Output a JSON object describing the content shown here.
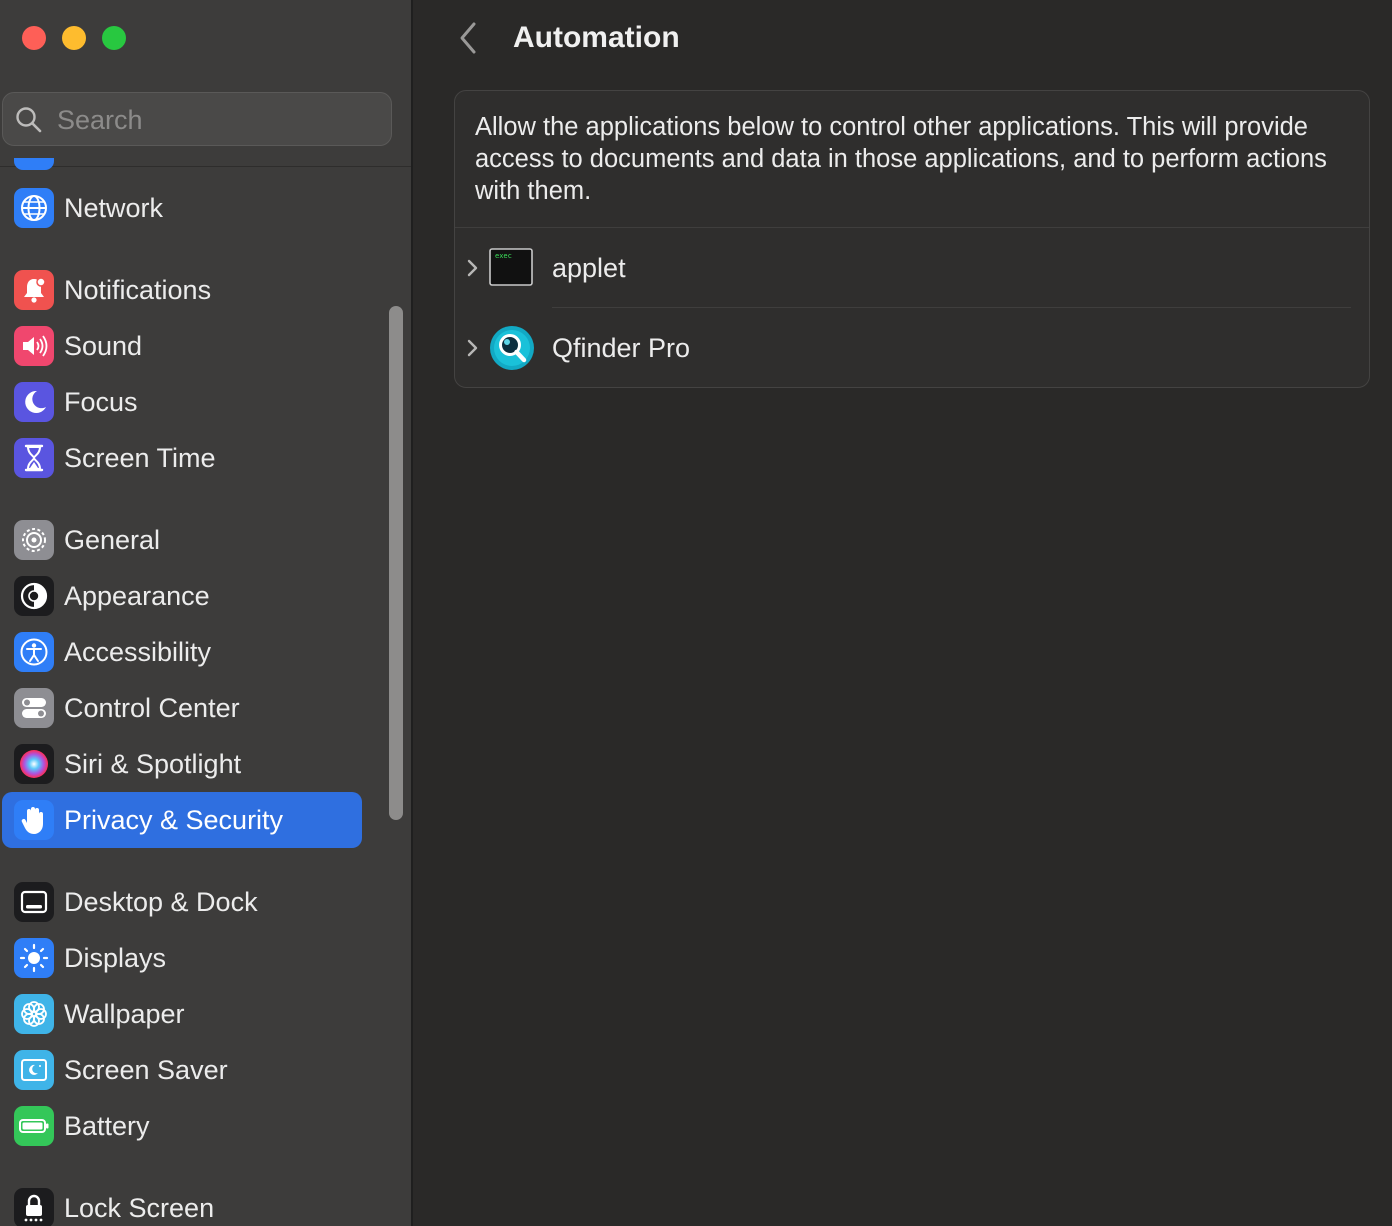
{
  "window": {
    "controls": [
      "close",
      "minimize",
      "zoom"
    ]
  },
  "search": {
    "placeholder": "Search"
  },
  "sidebar": {
    "items": [
      {
        "label": "Network",
        "icon": "network-globe-icon",
        "color": "#2f7ef7"
      },
      {
        "label": "Notifications",
        "icon": "notification-bell-icon",
        "color": "#f0524f"
      },
      {
        "label": "Sound",
        "icon": "speaker-icon",
        "color": "#f0476e"
      },
      {
        "label": "Focus",
        "icon": "moon-icon",
        "color": "#5a55e0"
      },
      {
        "label": "Screen Time",
        "icon": "hourglass-icon",
        "color": "#5a55e0"
      },
      {
        "label": "General",
        "icon": "gear-icon",
        "color": "#8e8e93"
      },
      {
        "label": "Appearance",
        "icon": "appearance-icon",
        "color": "#1c1c1e"
      },
      {
        "label": "Accessibility",
        "icon": "accessibility-icon",
        "color": "#2f7ef7"
      },
      {
        "label": "Control Center",
        "icon": "toggles-icon",
        "color": "#8e8e93"
      },
      {
        "label": "Siri & Spotlight",
        "icon": "siri-icon",
        "color": "#1c1c1e"
      },
      {
        "label": "Privacy & Security",
        "icon": "hand-icon",
        "color": "#2f7ef7",
        "selected": true
      },
      {
        "label": "Desktop & Dock",
        "icon": "dock-icon",
        "color": "#1c1c1e"
      },
      {
        "label": "Displays",
        "icon": "sun-icon",
        "color": "#2f7ef7"
      },
      {
        "label": "Wallpaper",
        "icon": "flower-icon",
        "color": "#3fb4e8"
      },
      {
        "label": "Screen Saver",
        "icon": "screen-saver-icon",
        "color": "#3fb4e8"
      },
      {
        "label": "Battery",
        "icon": "battery-icon",
        "color": "#34c759"
      },
      {
        "label": "Lock Screen",
        "icon": "lock-icon",
        "color": "#1c1c1e"
      }
    ]
  },
  "main": {
    "title": "Automation",
    "description": "Allow the applications below to control other applications. This will provide access to documents and data in those applications, and to perform actions with them.",
    "apps": [
      {
        "name": "applet",
        "icon": "terminal-exec-icon",
        "icon_text": "exec"
      },
      {
        "name": "Qfinder Pro",
        "icon": "qfinder-magnifier-icon"
      }
    ]
  }
}
